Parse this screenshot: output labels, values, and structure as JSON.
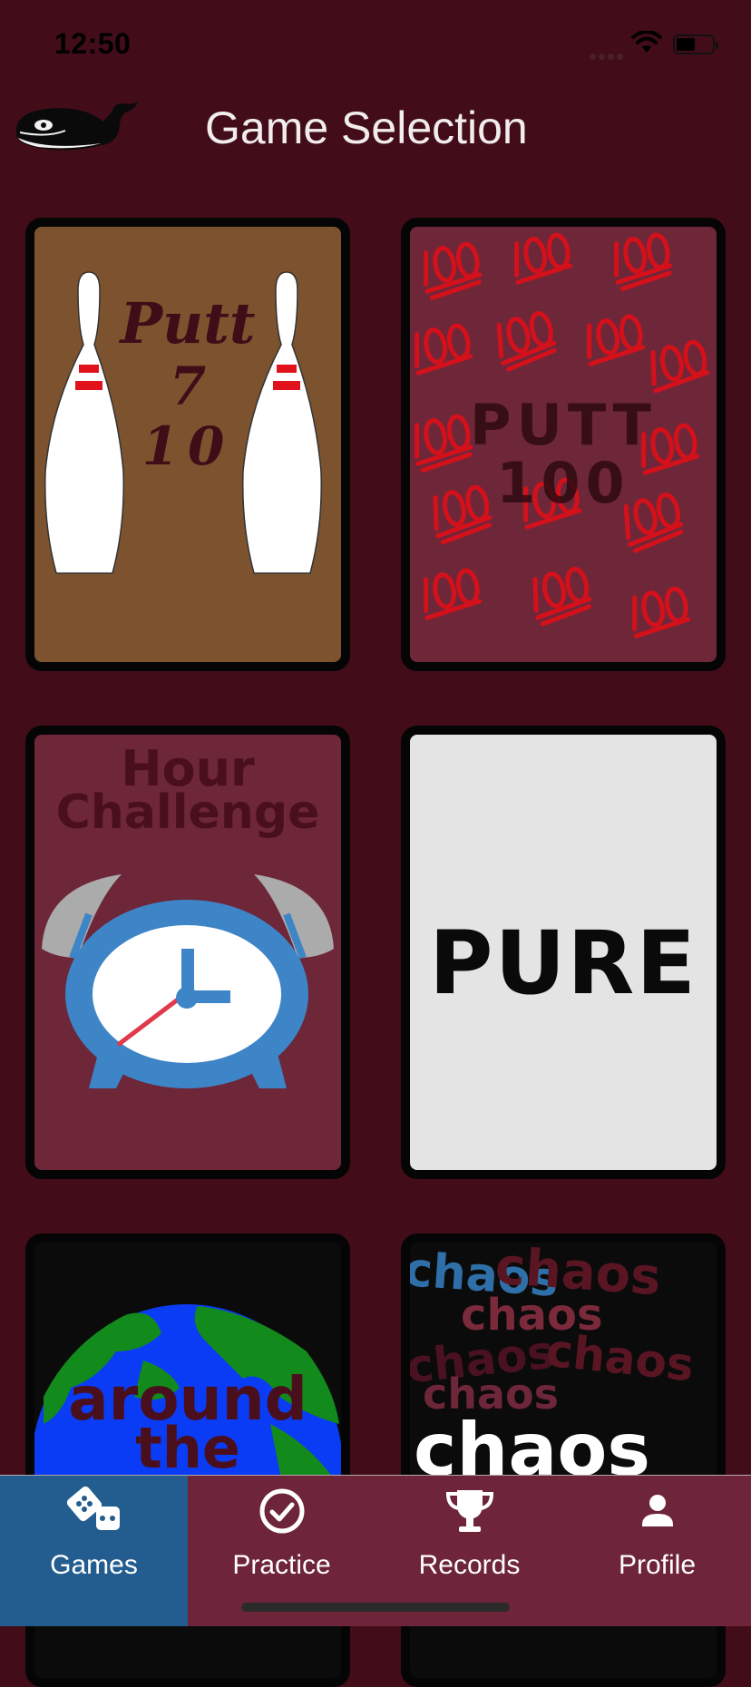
{
  "status_bar": {
    "time": "12:50"
  },
  "header": {
    "title": "Game Selection",
    "logo_icon": "whale-logo-icon"
  },
  "games": [
    {
      "name": "putt-7-10",
      "lines": [
        "Putt",
        "7",
        "10"
      ],
      "background": "#7C532E"
    },
    {
      "name": "putt-100",
      "lines": [
        "PUTT",
        "100"
      ],
      "background": "#6E2639"
    },
    {
      "name": "hour-challenge",
      "lines": [
        "Hour",
        "Challenge"
      ],
      "background": "#6E2639"
    },
    {
      "name": "pure",
      "lines": [
        "PURE"
      ],
      "background": "#E4E4E4"
    },
    {
      "name": "around-the-world",
      "lines": [
        "around",
        "the"
      ],
      "background": "#0B0B0B"
    },
    {
      "name": "chaos",
      "lines": [
        "chaos",
        "chaos",
        "chaos",
        "chaos",
        "chaos",
        "chaos",
        "chaos"
      ],
      "background": "#0B0B0B"
    }
  ],
  "tabbar": {
    "tabs": [
      {
        "label": "Games",
        "icon": "dice-icon",
        "active": true
      },
      {
        "label": "Practice",
        "icon": "check-circle-icon",
        "active": false
      },
      {
        "label": "Records",
        "icon": "trophy-icon",
        "active": false
      },
      {
        "label": "Profile",
        "icon": "person-icon",
        "active": false
      }
    ],
    "active_color": "#235C8F",
    "background_color": "#6E2439"
  },
  "colors": {
    "page_background": "#420D18",
    "accent_red": "#E1121C"
  }
}
